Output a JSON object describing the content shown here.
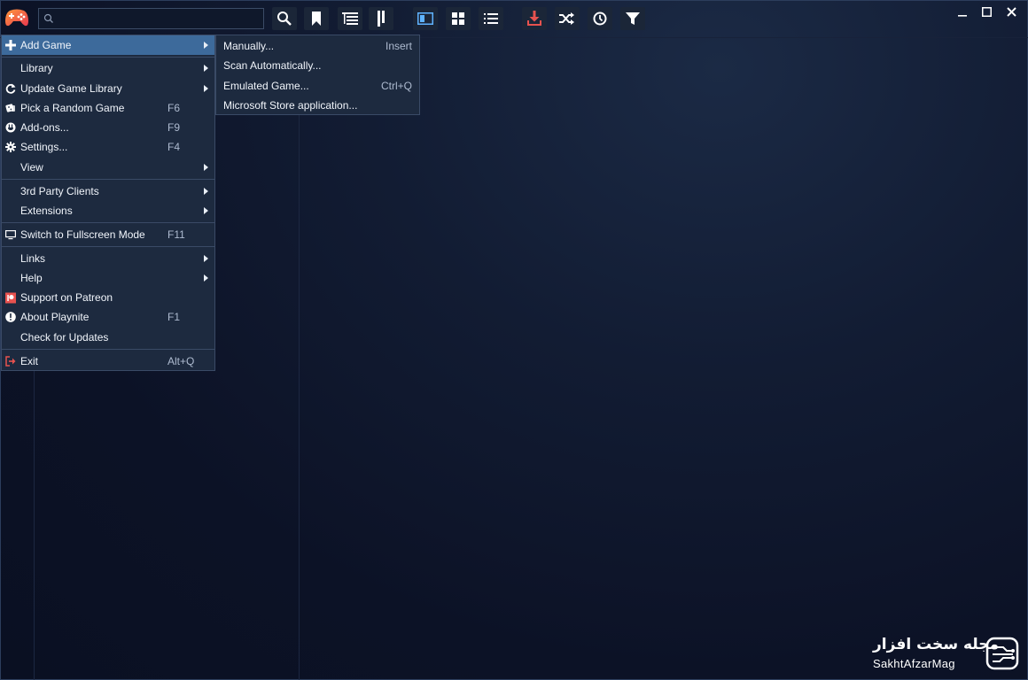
{
  "search": {
    "placeholder": "",
    "value": ""
  },
  "toolbar": {
    "buttons": [
      "search-icon",
      "bookmark-icon",
      "list-tree-icon",
      "panel-icon",
      "details-view-icon",
      "grid-view-icon",
      "list-view-icon",
      "download-icon",
      "shuffle-icon",
      "clock-icon",
      "filter-icon"
    ]
  },
  "window_controls": {
    "minimize": "–",
    "maximize": "□",
    "close": "✕"
  },
  "menu": {
    "items": [
      {
        "label": "Add Game",
        "shortcut": "",
        "icon": "plus-icon",
        "submenu": true
      },
      {
        "label": "Library",
        "shortcut": "",
        "icon": "",
        "submenu": true
      },
      {
        "label": "Update Game Library",
        "shortcut": "",
        "icon": "refresh-icon",
        "submenu": true
      },
      {
        "label": "Pick a Random Game",
        "shortcut": "F6",
        "icon": "dice-icon",
        "submenu": false
      },
      {
        "label": "Add-ons...",
        "shortcut": "F9",
        "icon": "plug-icon",
        "submenu": false
      },
      {
        "label": "Settings...",
        "shortcut": "F4",
        "icon": "gear-icon",
        "submenu": false
      },
      {
        "label": "View",
        "shortcut": "",
        "icon": "",
        "submenu": true
      },
      {
        "label": "3rd Party Clients",
        "shortcut": "",
        "icon": "",
        "submenu": true
      },
      {
        "label": "Extensions",
        "shortcut": "",
        "icon": "",
        "submenu": true
      },
      {
        "label": "Switch to Fullscreen Mode",
        "shortcut": "F11",
        "icon": "monitor-icon",
        "submenu": false
      },
      {
        "label": "Links",
        "shortcut": "",
        "icon": "",
        "submenu": true
      },
      {
        "label": "Help",
        "shortcut": "",
        "icon": "",
        "submenu": true
      },
      {
        "label": "Support on Patreon",
        "shortcut": "",
        "icon": "patreon-icon",
        "submenu": false
      },
      {
        "label": "About Playnite",
        "shortcut": "F1",
        "icon": "info-icon",
        "submenu": false
      },
      {
        "label": "Check for Updates",
        "shortcut": "",
        "icon": "",
        "submenu": false
      },
      {
        "label": "Exit",
        "shortcut": "Alt+Q",
        "icon": "exit-icon",
        "submenu": false
      }
    ]
  },
  "submenu": {
    "items": [
      {
        "label": "Manually...",
        "shortcut": "Insert"
      },
      {
        "label": "Scan Automatically...",
        "shortcut": ""
      },
      {
        "label": "Emulated Game...",
        "shortcut": "Ctrl+Q"
      },
      {
        "label": "Microsoft Store application...",
        "shortcut": ""
      }
    ]
  },
  "watermark": {
    "persian": "مجله سخت افزار",
    "english": "SakhtAfzarMag"
  },
  "colors": {
    "accent": "#3d6a9b",
    "menu_bg": "#1d2a3f",
    "download": "#e8524f",
    "patreon": "#e8524f",
    "exit": "#e8524f"
  }
}
